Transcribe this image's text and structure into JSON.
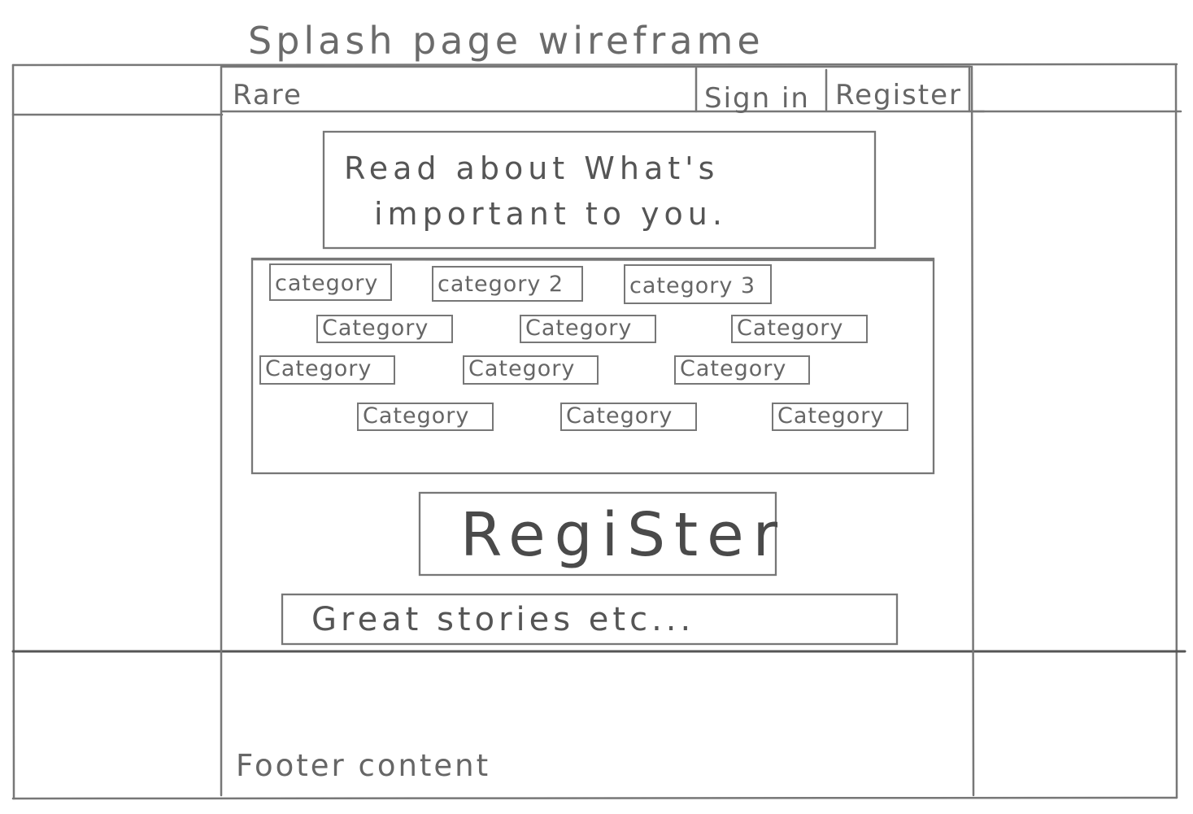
{
  "wireframe": {
    "title": "Splash page wireframe",
    "header": {
      "logo": "Rare",
      "sign_in": "Sign in",
      "register": "Register"
    },
    "hero": {
      "line1": "Read about What's",
      "line2": "important to you."
    },
    "categories": [
      "category",
      "category 2",
      "category 3",
      "Category",
      "Category",
      "Category",
      "Category",
      "Category",
      "Category",
      "Category",
      "Category",
      "Category"
    ],
    "register_button": "RegiSter",
    "stories": "Great stories etc...",
    "footer": "Footer content"
  }
}
